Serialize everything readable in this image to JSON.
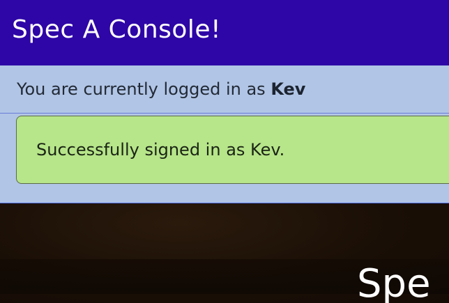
{
  "header": {
    "title": "Spec A Console!"
  },
  "login_bar": {
    "prefix": "You are currently logged in as ",
    "username": "Kev"
  },
  "alert": {
    "message": "Successfully signed in as Kev."
  },
  "hero": {
    "title": "Spe"
  },
  "colors": {
    "header_bg": "#2e05a6",
    "status_bg": "#b1c5e6",
    "alert_bg": "#b7e58a",
    "hero_bg": "#1a0f06"
  }
}
